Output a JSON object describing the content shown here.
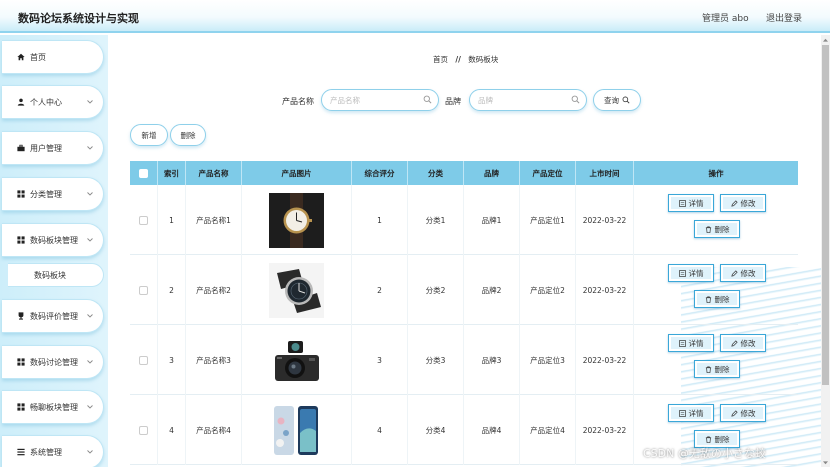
{
  "header": {
    "title": "数码论坛系统设计与实现",
    "user": "管理员 abo",
    "logout": "退出登录"
  },
  "sidebar": {
    "items": [
      {
        "label": "首页",
        "icon": "home-icon"
      },
      {
        "label": "个人中心",
        "icon": "person-icon"
      },
      {
        "label": "用户管理",
        "icon": "briefcase-icon"
      },
      {
        "label": "分类管理",
        "icon": "grid-icon"
      },
      {
        "label": "数码板块管理",
        "icon": "grid-icon"
      },
      {
        "label": "数码板块",
        "sub": true
      },
      {
        "label": "数码评价管理",
        "icon": "trophy-icon"
      },
      {
        "label": "数码讨论管理",
        "icon": "grid-icon"
      },
      {
        "label": "畅聊板块管理",
        "icon": "grid-icon"
      },
      {
        "label": "系统管理",
        "icon": "list-icon"
      }
    ]
  },
  "breadcrumb": {
    "home": "首页",
    "sep": "//",
    "current": "数码板块"
  },
  "search": {
    "name_label": "产品名称",
    "name_placeholder": "产品名称",
    "name_value": "",
    "brand_label": "品牌",
    "brand_placeholder": "品牌",
    "brand_value": "",
    "query_label": "查询"
  },
  "toolbar": {
    "add_label": "新增",
    "delete_label": "删除"
  },
  "table": {
    "headers": [
      "索引",
      "产品名称",
      "产品图片",
      "综合评分",
      "分类",
      "品牌",
      "产品定位",
      "上市时间",
      "操作"
    ],
    "rows": [
      {
        "index": "1",
        "name": "产品名称1",
        "image": "wristwatch",
        "score": "1",
        "category": "分类1",
        "brand": "品牌1",
        "position": "产品定位1",
        "date": "2022-03-22"
      },
      {
        "index": "2",
        "name": "产品名称2",
        "image": "wristwatch",
        "score": "2",
        "category": "分类2",
        "brand": "品牌2",
        "position": "产品定位2",
        "date": "2022-03-22"
      },
      {
        "index": "3",
        "name": "产品名称3",
        "image": "camera",
        "score": "3",
        "category": "分类3",
        "brand": "品牌3",
        "position": "产品定位3",
        "date": "2022-03-22"
      },
      {
        "index": "4",
        "name": "产品名称4",
        "image": "phones",
        "score": "4",
        "category": "分类4",
        "brand": "品牌4",
        "position": "产品定位4",
        "date": "2022-03-22"
      }
    ],
    "actions": {
      "detail": "详情",
      "edit": "修改",
      "delete": "删除"
    }
  },
  "watermark": "CSDN @无敌の小さな蛟",
  "colors": {
    "header_band": "#8fd3ee",
    "table_header": "#7ecbe8",
    "button_border": "#3aa7d8",
    "sidebar_bg": "#cdeefa"
  }
}
